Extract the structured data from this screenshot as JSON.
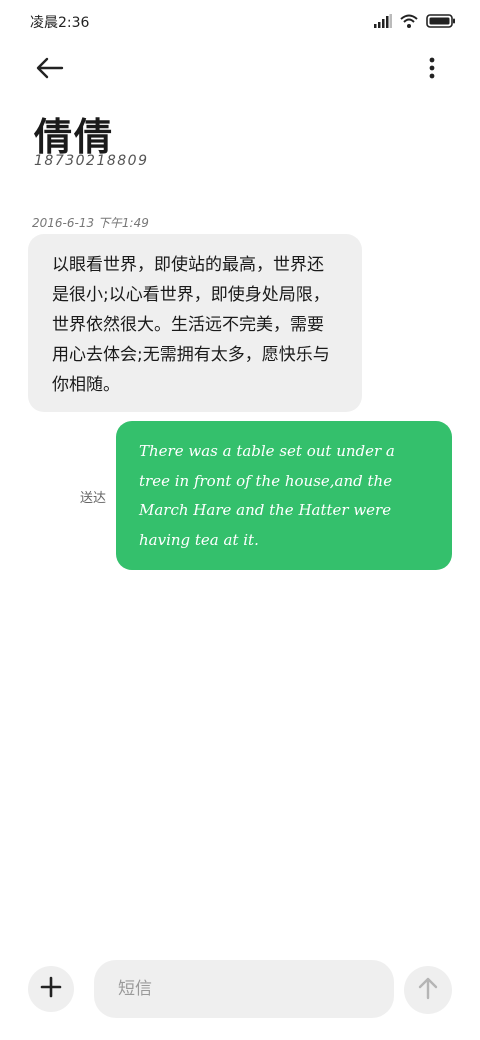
{
  "status_bar": {
    "time": "凌晨2:36",
    "icons": [
      "signal-icon",
      "wifi-icon",
      "battery-icon"
    ]
  },
  "topbar": {
    "back_icon": "back-arrow-icon",
    "more_icon": "more-vertical-icon"
  },
  "contact": {
    "name": "倩倩",
    "number": "18730218809"
  },
  "conversation": {
    "timestamp": "2016-6-13 下午1:49",
    "messages": [
      {
        "direction": "incoming",
        "text": "以眼看世界，即使站的最高，世界还是很小;以心看世界，即使身处局限，世界依然很大。生活远不完美，需要用心去体会;无需拥有太多，愿快乐与你相随。"
      },
      {
        "direction": "outgoing",
        "text": "There was a table set out under a tree in front of the house,and the March Hare and the Hatter were having tea at it.",
        "status": "送达"
      }
    ]
  },
  "composer": {
    "add_icon": "plus-icon",
    "placeholder": "短信",
    "send_icon": "send-arrow-up-icon"
  },
  "colors": {
    "outgoing_bubble": "#34c06c",
    "incoming_bubble": "#efefef",
    "background": "#ffffff"
  }
}
